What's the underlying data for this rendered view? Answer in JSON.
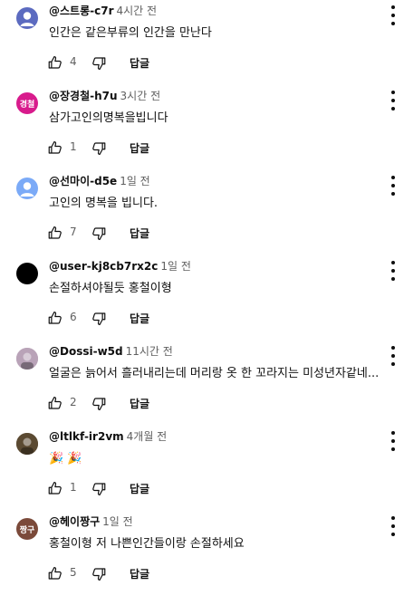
{
  "colors": {
    "text": "#0f0f0f",
    "secondary_text": "#606060"
  },
  "comments": [
    {
      "author": "@스트롱-c7r",
      "time": "4시간 전",
      "text": "인간은 같은부류의 인간을 만난다",
      "likes": "4",
      "reply_label": "답글",
      "avatar_kind": "default-person-icon",
      "avatar_color": "#5c6bc0"
    },
    {
      "author": "@장경철-h7u",
      "time": "3시간 전",
      "text": "삼가고인의명복을빕니다",
      "likes": "1",
      "reply_label": "답글",
      "avatar_kind": "initials",
      "avatar_initials": "경철",
      "avatar_color": "#d81b8c"
    },
    {
      "author": "@선마이-d5e",
      "time": "1일 전",
      "text": "고인의 명복을 빕니다.",
      "likes": "7",
      "reply_label": "답글",
      "avatar_kind": "default-person-icon",
      "avatar_color": "#7baaf7"
    },
    {
      "author": "@user-kj8cb7rx2c",
      "time": "1일 전",
      "text": "손절하셔야될듯 홍철이형",
      "likes": "6",
      "reply_label": "답글",
      "avatar_kind": "solid",
      "avatar_color": "#000000"
    },
    {
      "author": "@Dossi-w5d",
      "time": "11시간 전",
      "text": "얼굴은 늙어서 흘러내리는데 머리랑 옷 한 꼬라지는 미성년자같네...",
      "likes": "2",
      "reply_label": "답글",
      "avatar_kind": "photo",
      "avatar_color": "#b9a3b8"
    },
    {
      "author": "@ltlkf-ir2vm",
      "time": "4개월 전",
      "text": "🎉 🎉",
      "likes": "1",
      "reply_label": "답글",
      "avatar_kind": "photo",
      "avatar_color": "#5b4a32"
    },
    {
      "author": "@헤이짱구",
      "time": "1일 전",
      "text": "홍철이형 저 나쁜인간들이랑 손절하세요",
      "likes": "5",
      "reply_label": "답글",
      "avatar_kind": "initials",
      "avatar_initials": "짱구",
      "avatar_color": "#7b4a3a"
    }
  ]
}
